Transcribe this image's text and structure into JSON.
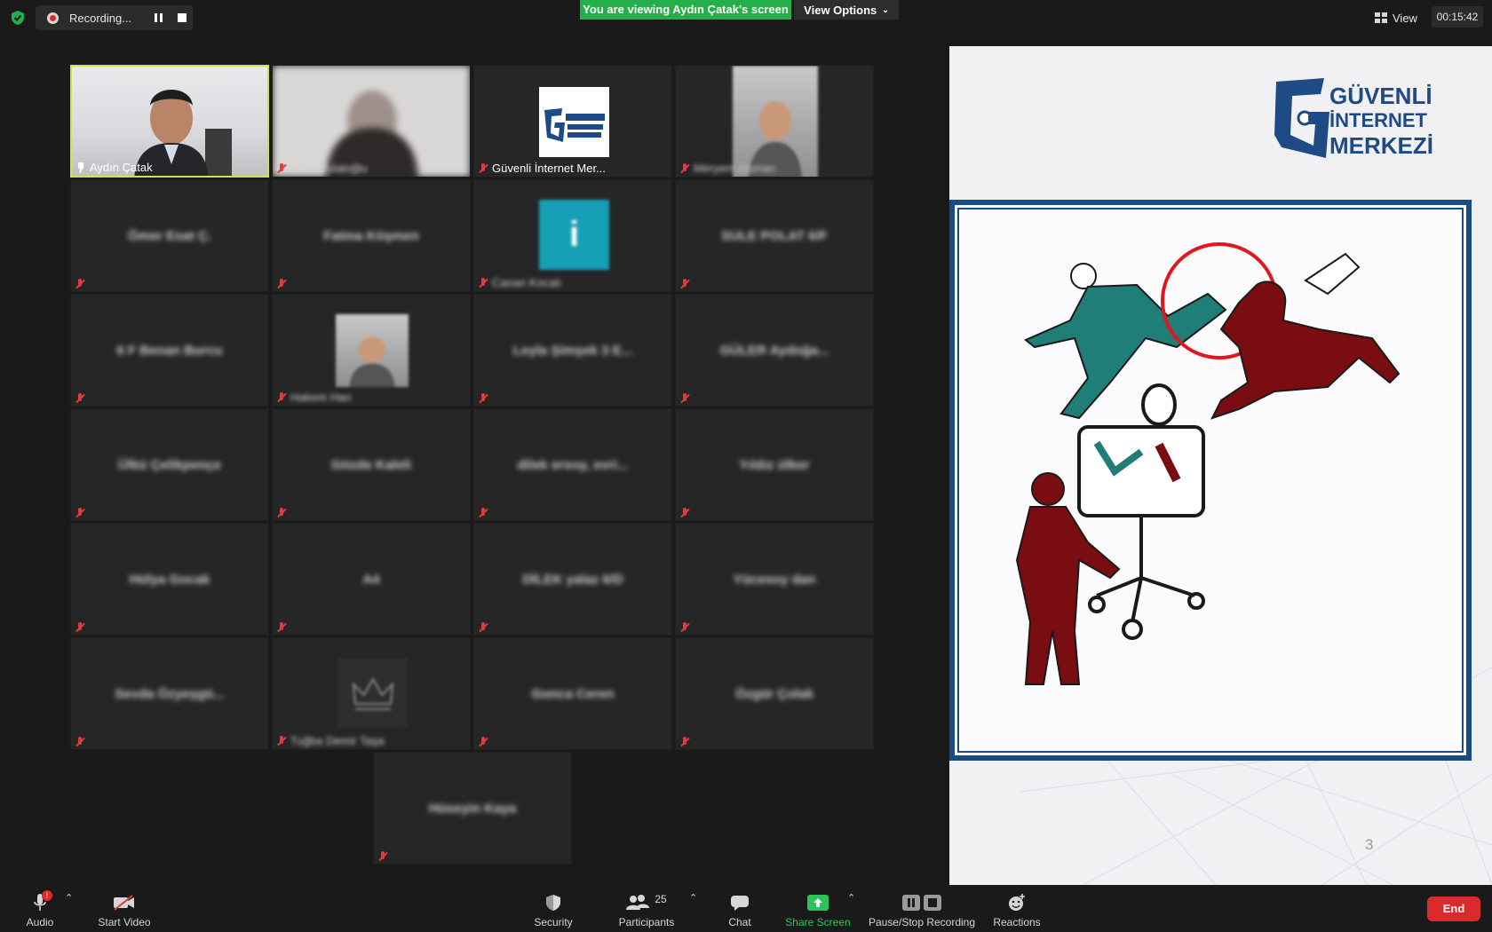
{
  "topbar": {
    "recording_label": "Recording...",
    "viewing_banner": "You are viewing Aydın Çatak's screen",
    "view_options": "View Options",
    "view_label": "View",
    "timer": "00:15:42"
  },
  "gallery": {
    "tiles": [
      {
        "name": "Aydın Çatak",
        "kind": "video",
        "label_blurred": false
      },
      {
        "name": "Ayşe Pulatoğlu",
        "kind": "video",
        "label_blurred": true
      },
      {
        "name": "Güvenli İnternet Mer...",
        "kind": "logo",
        "label_blurred": false
      },
      {
        "name": "Meryem Duman",
        "kind": "photo",
        "label_blurred": true
      },
      {
        "name": "Ömer Esat Ç.",
        "kind": "name"
      },
      {
        "name": "Fatma Köşmen",
        "kind": "name"
      },
      {
        "name": "Canan Kocalı",
        "kind": "initial",
        "initial": "i"
      },
      {
        "name": "SULE POLAT 6/F",
        "kind": "name"
      },
      {
        "name": "6 F Benan Burcu",
        "kind": "name"
      },
      {
        "name": "Hakem Han",
        "kind": "photo"
      },
      {
        "name": "Leyla Şimşek 3 E...",
        "kind": "name"
      },
      {
        "name": "GÜLER Aydoğa...",
        "kind": "name"
      },
      {
        "name": "Ülkü Çelikpençe",
        "kind": "name"
      },
      {
        "name": "Gözde Kaleli",
        "kind": "name"
      },
      {
        "name": "dilek ersoy, evri...",
        "kind": "name"
      },
      {
        "name": "Yıldız ülker",
        "kind": "name"
      },
      {
        "name": "Hülya Gocak",
        "kind": "name"
      },
      {
        "name": "A4",
        "kind": "name"
      },
      {
        "name": "DİLEK yalaz 6/D",
        "kind": "name"
      },
      {
        "name": "Yücesoy dan",
        "kind": "name"
      },
      {
        "name": "Sevda Özyeşgü...",
        "kind": "name"
      },
      {
        "name": "Tuğba Demir Taşa",
        "kind": "crown"
      },
      {
        "name": "Gonca Ceren",
        "kind": "name"
      },
      {
        "name": "Özgür Çolak",
        "kind": "name"
      },
      {
        "name": "Hüseyin Kaya",
        "kind": "name"
      }
    ]
  },
  "share": {
    "logo_line1": "GÜVENLİ",
    "logo_line2": "İNTERNET",
    "logo_line3": "MERKEZİ",
    "page_number": "3"
  },
  "toolbar": {
    "audio": "Audio",
    "start_video": "Start Video",
    "security": "Security",
    "participants": "Participants",
    "participants_count": "25",
    "chat": "Chat",
    "share_screen": "Share Screen",
    "pause_stop_recording": "Pause/Stop Recording",
    "reactions": "Reactions",
    "end": "End",
    "audio_badge": "!"
  },
  "colors": {
    "banner_green": "#23b04a",
    "end_red": "#d92b2b",
    "active_border": "#c8e35a",
    "share_green": "#2ec35a",
    "logo_blue": "#1e4a86"
  }
}
